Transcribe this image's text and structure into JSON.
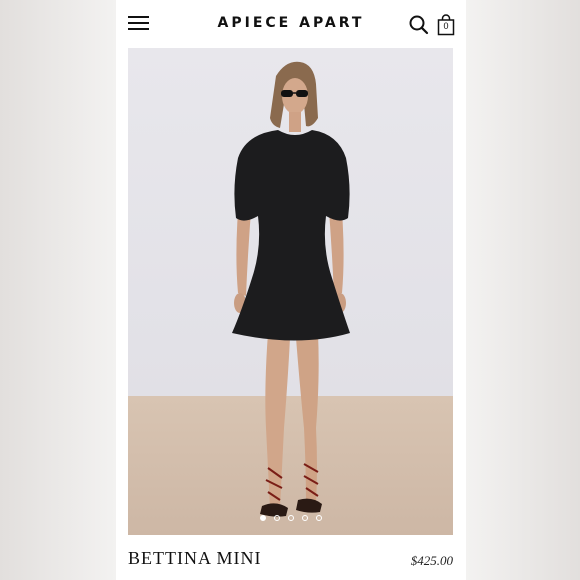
{
  "header": {
    "brand": "APIECE APART",
    "icons": {
      "menu": "hamburger-menu-icon",
      "search": "search-icon",
      "bag": "shopping-bag-icon"
    },
    "bag_count": "0"
  },
  "hero": {
    "image_alt": "Model wearing black mini dress",
    "carousel": {
      "total": 5,
      "active": 1
    }
  },
  "product": {
    "name": "BETTINA MINI",
    "price": "$425.00"
  },
  "colors": {
    "background": "#ffffff",
    "text": "#111111",
    "dress": "#1c1c1e",
    "wall": "#e4e3e8",
    "floor": "#d2bdaa"
  }
}
